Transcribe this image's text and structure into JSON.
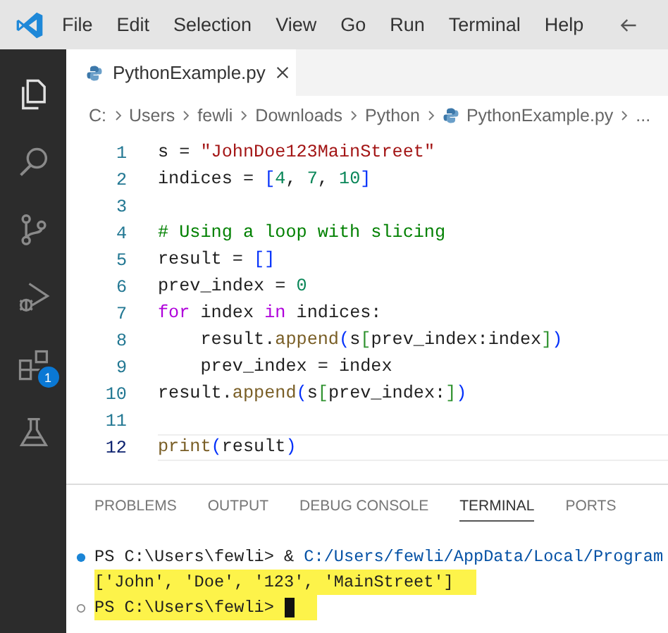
{
  "menu": {
    "items": [
      "File",
      "Edit",
      "Selection",
      "View",
      "Go",
      "Run",
      "Terminal",
      "Help"
    ]
  },
  "activity_bar": {
    "items": [
      {
        "kind": "explorer",
        "selected": true
      },
      {
        "kind": "search",
        "selected": false
      },
      {
        "kind": "source-control",
        "selected": false
      },
      {
        "kind": "run-debug",
        "selected": false
      },
      {
        "kind": "extensions",
        "selected": false,
        "badge": "1"
      },
      {
        "kind": "testing",
        "selected": false
      }
    ]
  },
  "tab": {
    "label": "PythonExample.py"
  },
  "breadcrumb": [
    "C:",
    "Users",
    "fewli",
    "Downloads",
    "Python",
    "PythonExample.py",
    "..."
  ],
  "code": [
    {
      "number": "1",
      "current": false,
      "tokens": [
        {
          "kind": "plain",
          "text": "s = "
        },
        {
          "kind": "string",
          "text": "\"JohnDoe123MainStreet\""
        }
      ]
    },
    {
      "number": "2",
      "current": false,
      "tokens": [
        {
          "kind": "plain",
          "text": "indices = "
        },
        {
          "kind": "bracket",
          "text": "["
        },
        {
          "kind": "number",
          "text": "4"
        },
        {
          "kind": "plain",
          "text": ", "
        },
        {
          "kind": "number",
          "text": "7"
        },
        {
          "kind": "plain",
          "text": ", "
        },
        {
          "kind": "number",
          "text": "10"
        },
        {
          "kind": "bracket",
          "text": "]"
        }
      ]
    },
    {
      "number": "3",
      "current": false
    },
    {
      "number": "4",
      "current": false,
      "tokens": [
        {
          "kind": "comment",
          "text": "# Using a loop with slicing"
        }
      ]
    },
    {
      "number": "5",
      "current": false,
      "tokens": [
        {
          "kind": "plain",
          "text": "result = "
        },
        {
          "kind": "bracket",
          "text": "[]"
        }
      ]
    },
    {
      "number": "6",
      "current": false,
      "tokens": [
        {
          "kind": "plain",
          "text": "prev_index = "
        },
        {
          "kind": "number",
          "text": "0"
        }
      ]
    },
    {
      "number": "7",
      "current": false,
      "tokens": [
        {
          "kind": "keyword",
          "text": "for"
        },
        {
          "kind": "plain",
          "text": " index "
        },
        {
          "kind": "keyword",
          "text": "in"
        },
        {
          "kind": "plain",
          "text": " indices:"
        }
      ]
    },
    {
      "number": "8",
      "current": false,
      "tokens": [
        {
          "kind": "plain",
          "text": "    result."
        },
        {
          "kind": "function",
          "text": "append"
        },
        {
          "kind": "bracket",
          "text": "("
        },
        {
          "kind": "plain",
          "text": "s"
        },
        {
          "kind": "bracket2",
          "text": "["
        },
        {
          "kind": "plain",
          "text": "prev_index:index"
        },
        {
          "kind": "bracket2",
          "text": "]"
        },
        {
          "kind": "bracket",
          "text": ")"
        }
      ]
    },
    {
      "number": "9",
      "current": false,
      "tokens": [
        {
          "kind": "plain",
          "text": "    prev_index = index"
        }
      ]
    },
    {
      "number": "10",
      "current": false,
      "tokens": [
        {
          "kind": "plain",
          "text": "result."
        },
        {
          "kind": "function",
          "text": "append"
        },
        {
          "kind": "bracket",
          "text": "("
        },
        {
          "kind": "plain",
          "text": "s"
        },
        {
          "kind": "bracket2",
          "text": "["
        },
        {
          "kind": "plain",
          "text": "prev_index:"
        },
        {
          "kind": "bracket2",
          "text": "]"
        },
        {
          "kind": "bracket",
          "text": ")"
        }
      ]
    },
    {
      "number": "11",
      "current": false
    },
    {
      "number": "12",
      "current": true,
      "tokens": [
        {
          "kind": "function",
          "text": "print"
        },
        {
          "kind": "bracket",
          "text": "("
        },
        {
          "kind": "plain",
          "text": "result"
        },
        {
          "kind": "bracket",
          "text": ")"
        }
      ]
    }
  ],
  "panel": {
    "tabs": [
      {
        "label": "PROBLEMS",
        "selected": false
      },
      {
        "label": "OUTPUT",
        "selected": false
      },
      {
        "label": "DEBUG CONSOLE",
        "selected": false
      },
      {
        "label": "TERMINAL",
        "selected": true
      },
      {
        "label": "PORTS",
        "selected": false
      }
    ],
    "terminal": [
      {
        "kind": "command",
        "highlighted": false,
        "cursor": false,
        "tokens": [
          {
            "kind": "plain",
            "text": "PS C:\\Users\\fewli> & "
          },
          {
            "kind": "path",
            "text": "C:/Users/fewli/AppData/Local/Program"
          }
        ]
      },
      {
        "kind": "output",
        "highlighted": true,
        "cursor": false,
        "tokens": [
          {
            "kind": "plain",
            "text": "['John', 'Doe', '123', 'MainStreet']"
          }
        ]
      },
      {
        "kind": "prompt",
        "highlighted": true,
        "cursor": true,
        "tokens": [
          {
            "kind": "plain",
            "text": "PS C:\\Users\\fewli> "
          }
        ]
      }
    ]
  }
}
